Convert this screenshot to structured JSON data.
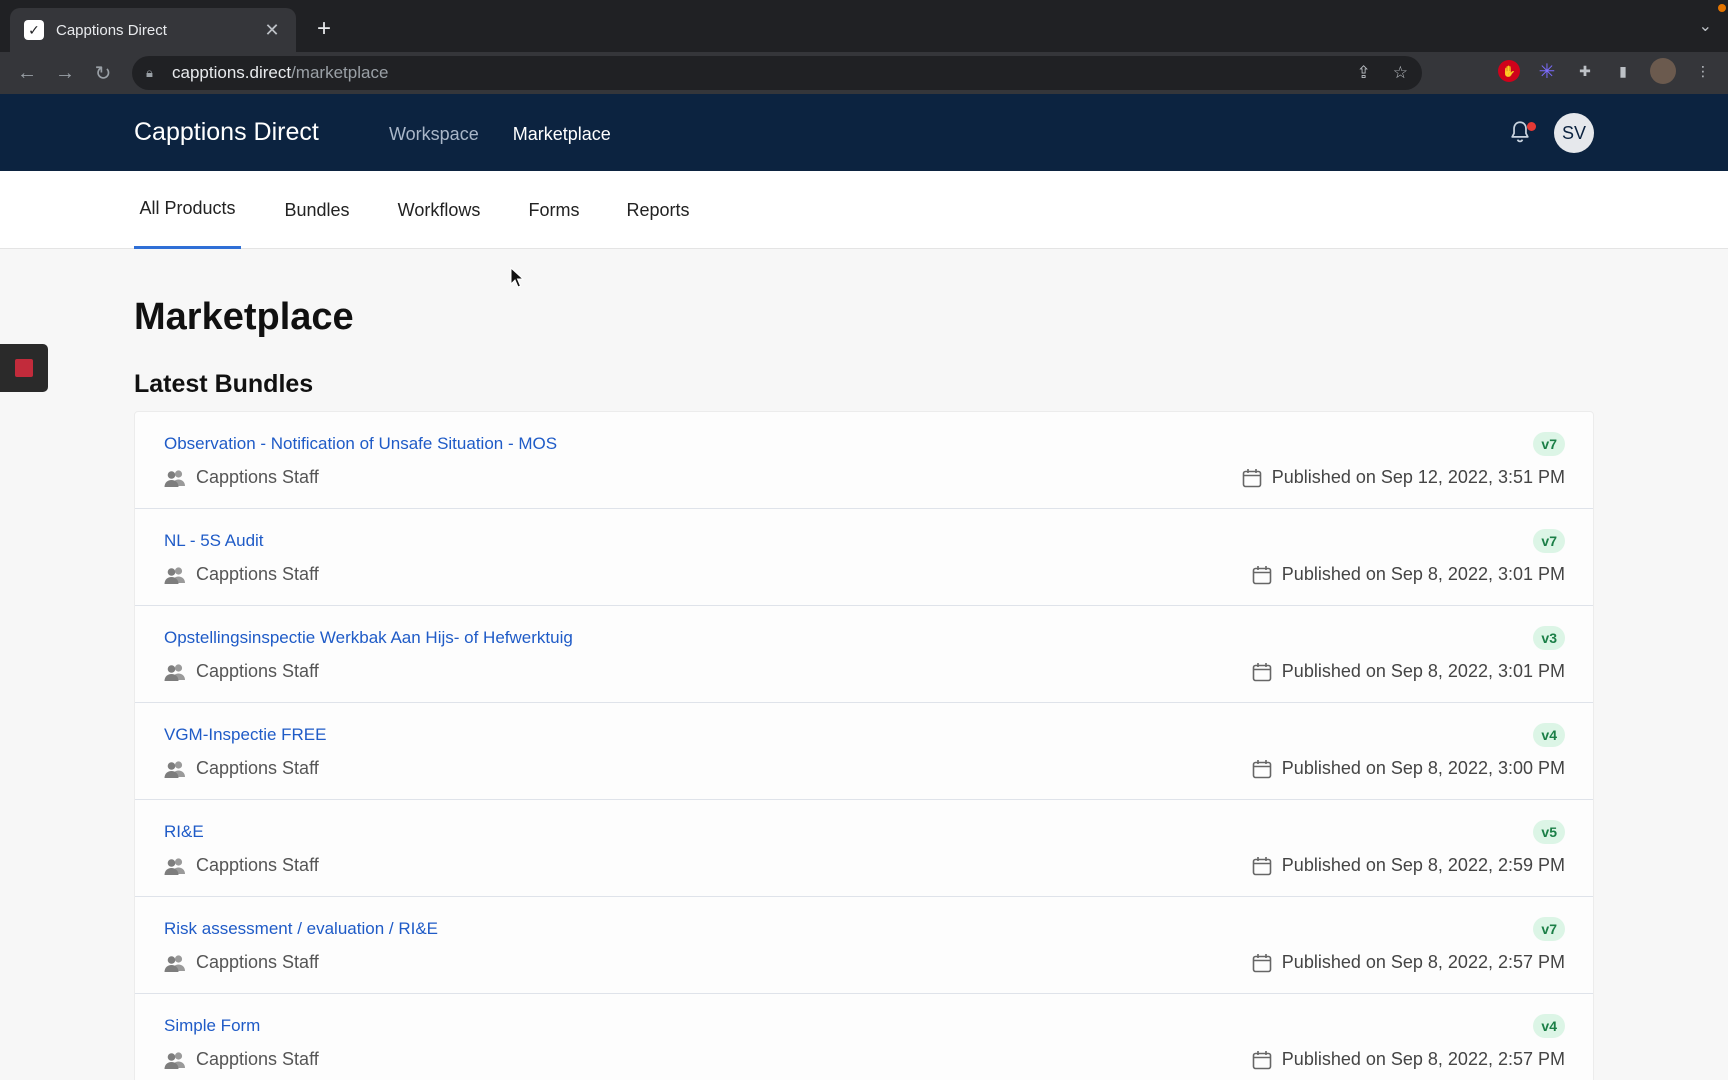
{
  "browser": {
    "tab_title": "Capptions Direct",
    "new_tab_symbol": "+",
    "close_symbol": "✕",
    "url_host": "capptions.direct",
    "url_path": "/marketplace"
  },
  "header": {
    "brand": "Capptions Direct",
    "nav": [
      {
        "label": "Workspace",
        "active": false
      },
      {
        "label": "Marketplace",
        "active": true
      }
    ],
    "user_initials": "SV"
  },
  "subnav": {
    "tabs": [
      {
        "label": "All Products",
        "active": true
      },
      {
        "label": "Bundles",
        "active": false
      },
      {
        "label": "Workflows",
        "active": false
      },
      {
        "label": "Forms",
        "active": false
      },
      {
        "label": "Reports",
        "active": false
      }
    ]
  },
  "main": {
    "title": "Marketplace",
    "section_title": "Latest Bundles",
    "bundles": [
      {
        "name": "Observation - Notification of Unsafe Situation - MOS",
        "owner": "Capptions Staff",
        "version": "v7",
        "published": "Published on Sep 12, 2022, 3:51 PM"
      },
      {
        "name": "NL - 5S Audit",
        "owner": "Capptions Staff",
        "version": "v7",
        "published": "Published on Sep 8, 2022, 3:01 PM"
      },
      {
        "name": "Opstellingsinspectie Werkbak Aan Hijs- of Hefwerktuig",
        "owner": "Capptions Staff",
        "version": "v3",
        "published": "Published on Sep 8, 2022, 3:01 PM"
      },
      {
        "name": "VGM-Inspectie FREE",
        "owner": "Capptions Staff",
        "version": "v4",
        "published": "Published on Sep 8, 2022, 3:00 PM"
      },
      {
        "name": "RI&E",
        "owner": "Capptions Staff",
        "version": "v5",
        "published": "Published on Sep 8, 2022, 2:59 PM"
      },
      {
        "name": "Risk assessment / evaluation / RI&E",
        "owner": "Capptions Staff",
        "version": "v7",
        "published": "Published on Sep 8, 2022, 2:57 PM"
      },
      {
        "name": "Simple Form",
        "owner": "Capptions Staff",
        "version": "v4",
        "published": "Published on Sep 8, 2022, 2:57 PM"
      }
    ]
  },
  "colors": {
    "header_bg": "#0c2340",
    "link": "#1f5bc7",
    "active_tab": "#2f6fd6",
    "badge_bg": "#dcf5e6",
    "badge_text": "#1b7f47"
  }
}
